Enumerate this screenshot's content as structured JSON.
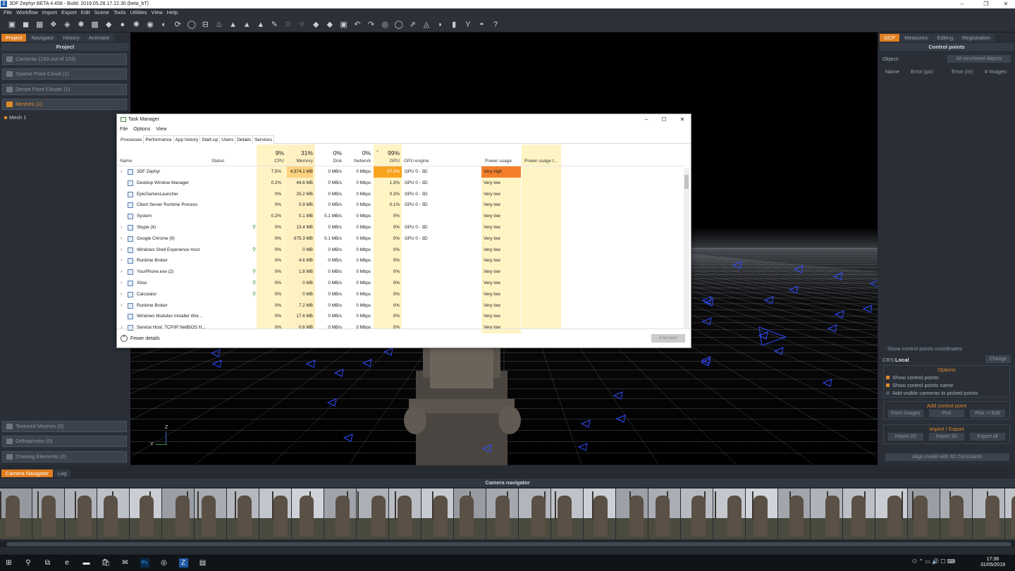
{
  "window": {
    "title": "3DF Zephyr BETA 4.458 - Build: 2019.05.28.17.12.30 (beta_bT)",
    "icon_letter": "Z",
    "controls": [
      "–",
      "❐",
      "✕"
    ]
  },
  "menu": [
    "File",
    "Workflow",
    "Import",
    "Export",
    "Edit",
    "Scene",
    "Tools",
    "Utilities",
    "View",
    "Help"
  ],
  "toolbar_icons": [
    "▣",
    "◼",
    "▦",
    "❖",
    "◈",
    "✱",
    "▩",
    "◆",
    "●",
    "✺",
    "◉",
    "◐",
    "⟳",
    "◯",
    "⊟",
    "♨",
    "▲",
    "▲",
    "▲",
    "✎",
    "⁙",
    "⁘",
    "◆",
    "◆",
    "▣",
    "↶",
    "↷",
    "◎",
    "◯",
    "⇗",
    "◬",
    "◗",
    "▮",
    "Y",
    "◓",
    "?"
  ],
  "left_panel": {
    "tabs": [
      "Project",
      "Navigator",
      "History",
      "Animator"
    ],
    "title": "Project",
    "layers": [
      {
        "label": "Cameras (153 out of 153)",
        "active": false
      },
      {
        "label": "Sparse Point Cloud (1)",
        "active": false
      },
      {
        "label": "Dense Point Clouds (1)",
        "active": false
      },
      {
        "label": "Meshes (1)",
        "active": true
      }
    ],
    "mesh_item": "Mesh 1",
    "bottom_layers": [
      {
        "label": "Textured Meshes (0)"
      },
      {
        "label": "Orthophotos (0)"
      },
      {
        "label": "Drawing Elements (0)"
      }
    ]
  },
  "viewport": {
    "axis_z": "Z",
    "axis_y": "Y"
  },
  "right_panel": {
    "tabs": [
      "GCP",
      "Measures",
      "Editing",
      "Registration"
    ],
    "title": "Control points",
    "object_label": "Object:",
    "object_value": "All structured objects",
    "columns": [
      "Name",
      "Error (px)",
      "Error (m)",
      "# Images"
    ],
    "show_coords": "Show control points coordinates",
    "crs_label": "CRS:",
    "crs_value": "Local",
    "change_button": "Change",
    "options_header": "Options",
    "options": [
      {
        "label": "Show control points",
        "checked": true
      },
      {
        "label": "Show control points name",
        "checked": true
      },
      {
        "label": "Add visible cameras to picked points",
        "checked": false
      }
    ],
    "add_header": "Add control point",
    "add_buttons": [
      "From images",
      "Pick",
      "Pick -> Edit"
    ],
    "import_header": "Import / Export",
    "import_buttons": [
      "Import 2D",
      "Import 3D",
      "Export all"
    ],
    "align_button": "Align model with 3D Constraints"
  },
  "bottom_panel": {
    "tabs": [
      "Camera Navigator",
      "Log"
    ],
    "title": "Camera navigator"
  },
  "task_manager": {
    "title": "Task Manager",
    "menu": [
      "File",
      "Options",
      "View"
    ],
    "tabs": [
      "Processes",
      "Performance",
      "App history",
      "Start-up",
      "Users",
      "Details",
      "Services"
    ],
    "totals": {
      "cpu": "9%",
      "memory": "31%",
      "disk": "0%",
      "network": "0%",
      "gpu": "99%"
    },
    "columns": {
      "name": "Name",
      "status": "Status",
      "cpu": "CPU",
      "memory": "Memory",
      "disk": "Disk",
      "network": "Network",
      "gpu": "GPU",
      "gpu_engine": "GPU engine",
      "power": "Power usage",
      "power_trend": "Power usage t..."
    },
    "rows": [
      {
        "name": "3DF Zephyr",
        "expand": true,
        "leaf": false,
        "cpu": "7.5%",
        "memory": "4,974.1 MB",
        "disk": "0 MB/s",
        "network": "0 Mbps",
        "gpu": "97.5%",
        "gpu_engine": "GPU 0 - 3D",
        "power": "Very high"
      },
      {
        "name": "Desktop Window Manager",
        "expand": false,
        "leaf": false,
        "cpu": "0.2%",
        "memory": "44.6 MB",
        "disk": "0 MB/s",
        "network": "0 Mbps",
        "gpu": "1.3%",
        "gpu_engine": "GPU 0 - 3D",
        "power": "Very low"
      },
      {
        "name": "EpicGamesLauncher",
        "expand": false,
        "leaf": false,
        "cpu": "0%",
        "memory": "25.2 MB",
        "disk": "0 MB/s",
        "network": "0 Mbps",
        "gpu": "0.3%",
        "gpu_engine": "GPU 0 - 3D",
        "power": "Very low"
      },
      {
        "name": "Client Server Runtime Process",
        "expand": false,
        "leaf": false,
        "cpu": "0%",
        "memory": "0.9 MB",
        "disk": "0 MB/s",
        "network": "0 Mbps",
        "gpu": "0.1%",
        "gpu_engine": "GPU 0 - 3D",
        "power": "Very low"
      },
      {
        "name": "System",
        "expand": false,
        "leaf": false,
        "cpu": "0.2%",
        "memory": "0.1 MB",
        "disk": "0.1 MB/s",
        "network": "0 Mbps",
        "gpu": "0%",
        "gpu_engine": "",
        "power": "Very low"
      },
      {
        "name": "Skype (4)",
        "expand": true,
        "leaf": true,
        "cpu": "0%",
        "memory": "13.4 MB",
        "disk": "0 MB/s",
        "network": "0 Mbps",
        "gpu": "0%",
        "gpu_engine": "GPU 0 - 3D",
        "power": "Very low"
      },
      {
        "name": "Google Chrome (9)",
        "expand": true,
        "leaf": false,
        "cpu": "0%",
        "memory": "675.3 MB",
        "disk": "0.1 MB/s",
        "network": "0 Mbps",
        "gpu": "0%",
        "gpu_engine": "GPU 0 - 3D",
        "power": "Very low"
      },
      {
        "name": "Windows Shell Experience Host",
        "expand": true,
        "leaf": true,
        "cpu": "0%",
        "memory": "0 MB",
        "disk": "0 MB/s",
        "network": "0 Mbps",
        "gpu": "0%",
        "gpu_engine": "",
        "power": "Very low"
      },
      {
        "name": "Runtime Broker",
        "expand": true,
        "leaf": false,
        "cpu": "0%",
        "memory": "4.6 MB",
        "disk": "0 MB/s",
        "network": "0 Mbps",
        "gpu": "0%",
        "gpu_engine": "",
        "power": "Very low"
      },
      {
        "name": "YourPhone.exe (2)",
        "expand": true,
        "leaf": true,
        "cpu": "0%",
        "memory": "1.8 MB",
        "disk": "0 MB/s",
        "network": "0 Mbps",
        "gpu": "0%",
        "gpu_engine": "",
        "power": "Very low"
      },
      {
        "name": "Xbox",
        "expand": true,
        "leaf": true,
        "cpu": "0%",
        "memory": "0 MB",
        "disk": "0 MB/s",
        "network": "0 Mbps",
        "gpu": "0%",
        "gpu_engine": "",
        "power": "Very low"
      },
      {
        "name": "Calculator",
        "expand": true,
        "leaf": true,
        "cpu": "0%",
        "memory": "0 MB",
        "disk": "0 MB/s",
        "network": "0 Mbps",
        "gpu": "0%",
        "gpu_engine": "",
        "power": "Very low"
      },
      {
        "name": "Runtime Broker",
        "expand": true,
        "leaf": false,
        "cpu": "0%",
        "memory": "7.2 MB",
        "disk": "0 MB/s",
        "network": "0 Mbps",
        "gpu": "0%",
        "gpu_engine": "",
        "power": "Very low"
      },
      {
        "name": "Windows Modules Installer Wor...",
        "expand": false,
        "leaf": false,
        "cpu": "0%",
        "memory": "17.6 MB",
        "disk": "0 MB/s",
        "network": "0 Mbps",
        "gpu": "0%",
        "gpu_engine": "",
        "power": "Very low"
      },
      {
        "name": "Service Host: TCP/IP NetBIOS H...",
        "expand": true,
        "leaf": false,
        "cpu": "0%",
        "memory": "0.6 MB",
        "disk": "0 MB/s",
        "network": "0 Mbps",
        "gpu": "0%",
        "gpu_engine": "",
        "power": "Very low"
      }
    ],
    "fewer_details": "Fewer details",
    "end_task": "End task"
  },
  "taskbar": {
    "icons": [
      "⊞",
      "⚲",
      "⧉",
      "e",
      "▬",
      "🛍",
      "✉",
      "Ps",
      "◎",
      "Z",
      "▤"
    ],
    "time": "17:36",
    "date": "31/05/2019"
  },
  "colors": {
    "accent": "#e07e1f",
    "cpu_hot": "#ffd27f",
    "cpu_warm": "#fff0c2",
    "power_high": "#f47f2a",
    "power_col": "#fff4c4"
  }
}
